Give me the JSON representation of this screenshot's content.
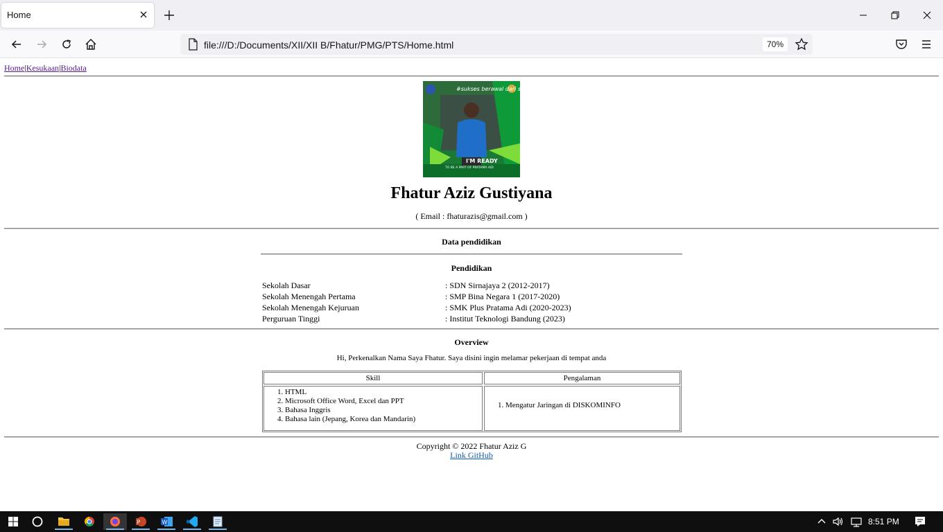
{
  "browser": {
    "tab_title": "Home",
    "url": "file:///D:/Documents/XII/XII B/Fhatur/PMG/PTS/Home.html",
    "zoom": "70%",
    "icons": [
      "close-icon",
      "plus-icon",
      "minimize-icon",
      "restore-icon",
      "back-icon",
      "forward-icon",
      "reload-icon",
      "home-icon",
      "page-icon",
      "star-icon",
      "pocket-icon",
      "menu-icon"
    ]
  },
  "nav": {
    "links": [
      "Home",
      "Kesukaan",
      "Biodata"
    ],
    "separator": "|"
  },
  "profile": {
    "photo_text_top": "#sukses berawal dari sini",
    "photo_text_bottom": "I'M READY",
    "photo_text_sub": "TO BE A PART OF PRATAMA ADI",
    "name": "Fhatur Aziz Gustiyana",
    "email": "( Email : fhaturazis@gmail.com )"
  },
  "education": {
    "section_title": "Data pendidikan",
    "subtitle": "Pendidikan",
    "rows": [
      {
        "level": "Sekolah Dasar",
        "value": ": SDN Sirnajaya 2 (2012-2017)"
      },
      {
        "level": "Sekolah Menengah Pertama",
        "value": ": SMP Bina Negara 1 (2017-2020)"
      },
      {
        "level": "Sekolah Menengah Kejuruan",
        "value": ": SMK Plus Pratama Adi (2020-2023)"
      },
      {
        "level": "Perguruan Tinggi",
        "value": ": Institut Teknologi Bandung (2023)"
      }
    ]
  },
  "overview": {
    "title": "Overview",
    "text": "Hi, Perkenalkan Nama Saya Fhatur. Saya disini ingin melamar pekerjaan di tempat anda",
    "table": {
      "headers": [
        "Skill",
        "Pengalaman"
      ],
      "skills": [
        "HTML",
        "Microsoft Office Word, Excel dan PPT",
        "Bahasa Inggris",
        "Bahasa lain (Jepang, Korea dan Mandarin)"
      ],
      "experience": [
        "Mengatur Jaringan di DISKOMINFO"
      ]
    }
  },
  "footer": {
    "copyright": "Copyright © 2022 Fhatur Aziz G",
    "link": "Link GitHub"
  },
  "taskbar": {
    "time": "8:51 PM",
    "apps": [
      "start-icon",
      "search-icon",
      "file-explorer-icon",
      "chrome-icon",
      "firefox-icon",
      "powerpoint-icon",
      "word-icon",
      "vscode-icon",
      "notepad-icon"
    ]
  },
  "colors": {
    "link_visited": "#551a8b",
    "link": "#0b5bb5",
    "taskbar": "#0f0f10",
    "tabbar": "#f0f0f4"
  }
}
